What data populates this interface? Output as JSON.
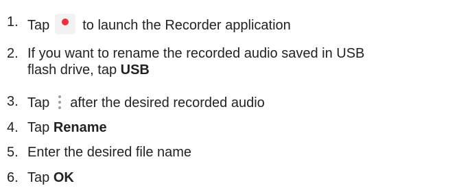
{
  "steps": [
    {
      "num": "1.",
      "before": "Tap",
      "icon": "record-icon",
      "after": "to launch the Recorder application"
    },
    {
      "num": "2.",
      "line1": "If you want to rename the recorded audio saved in USB",
      "line2_prefix": "flash drive, tap ",
      "bold": "USB"
    },
    {
      "num": "3.",
      "before": "Tap",
      "icon": "more-options-icon",
      "after": "after the desired recorded audio"
    },
    {
      "num": "4.",
      "prefix": "Tap ",
      "bold": "Rename"
    },
    {
      "num": "5.",
      "text": "Enter the desired file name"
    },
    {
      "num": "6.",
      "prefix": "Tap ",
      "bold": "OK"
    }
  ],
  "colors": {
    "text": "#222222",
    "record_dot": "#e8313a",
    "icon_background": "#f2f2f2",
    "more_dots": "#9e9e9e"
  }
}
